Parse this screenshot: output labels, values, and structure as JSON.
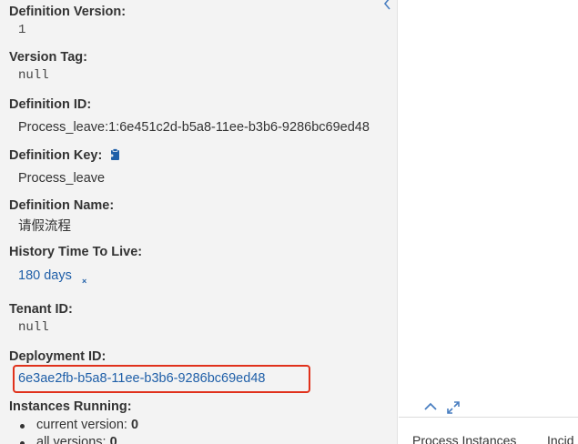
{
  "details": {
    "definition_version": {
      "label": "Definition Version:",
      "value": "1"
    },
    "version_tag": {
      "label": "Version Tag:",
      "value": "null"
    },
    "definition_id": {
      "label": "Definition ID:",
      "value": "Process_leave:1:6e451c2d-b5a8-11ee-b3b6-9286bc69ed48"
    },
    "definition_key": {
      "label": "Definition Key:",
      "value": "Process_leave",
      "icon": "clipboard-icon"
    },
    "definition_name": {
      "label": "Definition Name:",
      "value": "请假流程"
    },
    "history_ttl": {
      "label": "History Time To Live:",
      "value": "180 days",
      "edit_glyph": "×"
    },
    "tenant_id": {
      "label": "Tenant ID:",
      "value": "null"
    },
    "deployment_id": {
      "label": "Deployment ID:",
      "value": "6e3ae2fb-b5a8-11ee-b3b6-9286bc69ed48"
    },
    "instances_running": {
      "label": "Instances Running:",
      "items": [
        {
          "text": "current version: ",
          "count": "0"
        },
        {
          "text": "all versions: ",
          "count": "0"
        }
      ]
    }
  },
  "controls": {
    "collapse_icon": "chevron-left-icon",
    "up_icon": "chevron-up-icon",
    "expand_icon": "expand-icon"
  },
  "tabs": [
    {
      "label": "Process Instances"
    },
    {
      "label": "Incid"
    }
  ],
  "colors": {
    "link": "#1f5fa8",
    "highlight": "#e0311b",
    "panel_bg": "#f3f3f3"
  }
}
